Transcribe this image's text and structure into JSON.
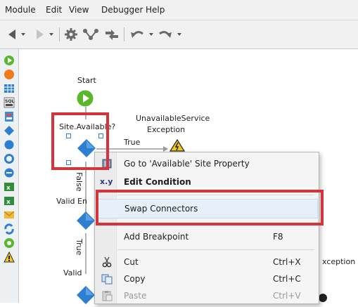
{
  "menubar": {
    "items": [
      "Module",
      "Edit",
      "View",
      "Debugger",
      "Help"
    ]
  },
  "toolbar": {
    "buttons": [
      "back-arrow-icon",
      "forward-arrow-icon",
      "gear-icon",
      "connector-icon",
      "split-arrows-icon",
      "undo-icon",
      "redo-icon"
    ]
  },
  "palette": {
    "icons": [
      "start-icon",
      "end-icon",
      "table-icon",
      "sql-icon",
      "records-icon",
      "if-icon",
      "foreach-icon",
      "cycle-icon",
      "sub-icon",
      "assign-excel-icon",
      "excel-icon",
      "email-icon",
      "refresh-icon",
      "run-icon",
      "warning-icon"
    ]
  },
  "canvas": {
    "start_label": "Start",
    "if1_label": "Site.Available?",
    "exception_label_line1": "UnavailableService",
    "exception_label_line2": "Exception",
    "true_label": "True",
    "false_label": "False",
    "valid1_label": "Valid En",
    "true_label_2": "True",
    "valid2_label": "Valid",
    "exception2_partial": "xception"
  },
  "context_menu": {
    "items": [
      {
        "label": "Go to 'Available' Site Property",
        "shortcut": "",
        "icon": "site-property-icon",
        "disabled": false
      },
      {
        "label": "Edit Condition",
        "shortcut": "",
        "icon": "xy-icon",
        "icon_text": "x.y",
        "disabled": false,
        "bold": true
      },
      {
        "label": "Swap Connectors",
        "shortcut": "",
        "icon": "",
        "disabled": false,
        "highlighted": true
      },
      {
        "label": "Add Breakpoint",
        "shortcut": "F8",
        "icon": "",
        "disabled": false
      },
      {
        "label": "Cut",
        "shortcut": "Ctrl+X",
        "icon": "scissors-icon",
        "disabled": false
      },
      {
        "label": "Copy",
        "shortcut": "Ctrl+C",
        "icon": "copy-icon",
        "disabled": false
      },
      {
        "label": "Paste",
        "shortcut": "Ctrl+V",
        "icon": "paste-icon",
        "disabled": true
      }
    ]
  },
  "colors": {
    "highlight_red": "#d6343d",
    "node_blue": "#2f7fd0",
    "start_green": "#58b82a",
    "menu_hover": "#e6f0fa"
  }
}
